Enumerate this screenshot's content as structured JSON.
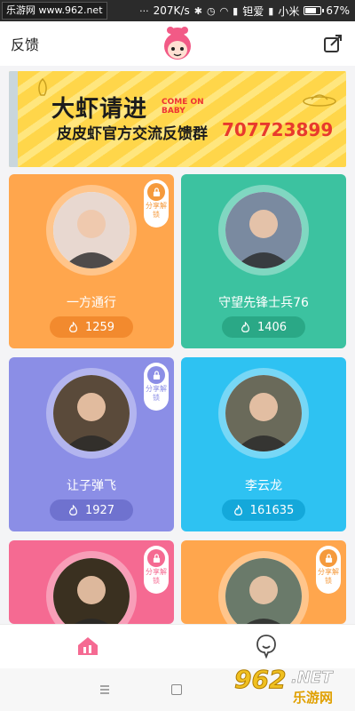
{
  "status_bar": {
    "watermark": "乐游网 www.962.net",
    "speed": "207K/s",
    "carrier": "钽爱",
    "carrier2": "小米",
    "battery": "67%",
    "battery_level": 0.67
  },
  "header": {
    "feedback_label": "反馈"
  },
  "banner": {
    "title": "大虾请进",
    "title_en": "COME ON BABY",
    "group_text": "皮皮虾官方交流反馈群",
    "group_number": "707723899"
  },
  "cards": [
    {
      "name": "一方通行",
      "count": "1259",
      "locked": true,
      "lock_text": "分享解锁",
      "color": "#ffa64d",
      "pill": "#f28a2e",
      "accent": "#f59a3c"
    },
    {
      "name": "守望先锋士兵76",
      "count": "1406",
      "locked": false,
      "color": "#3cc2a0",
      "pill": "#2aa886",
      "accent": "#2aa886"
    },
    {
      "name": "让子弹飞",
      "count": "1927",
      "locked": true,
      "lock_text": "分享解锁",
      "color": "#8b8ee6",
      "pill": "#6f72cf",
      "accent": "#8b8ee6"
    },
    {
      "name": "李云龙",
      "count": "161635",
      "locked": false,
      "color": "#2ec2f2",
      "pill": "#14a8da",
      "accent": "#14a8da"
    },
    {
      "name": "",
      "count": "",
      "locked": true,
      "lock_text": "分享解锁",
      "color": "#f56a92",
      "pill": "#e0507c",
      "accent": "#f56a92"
    },
    {
      "name": "",
      "count": "",
      "locked": true,
      "lock_text": "分享解锁",
      "color": "#ffa64d",
      "pill": "#f28a2e",
      "accent": "#f59a3c"
    }
  ],
  "watermark_bottom": {
    "num": "962",
    "net": ".NET",
    "cn": "乐游网"
  },
  "colors": {
    "home_icon": "#f56a92",
    "banner_bg": "#ffd64a",
    "banner_number": "#e8392d"
  }
}
